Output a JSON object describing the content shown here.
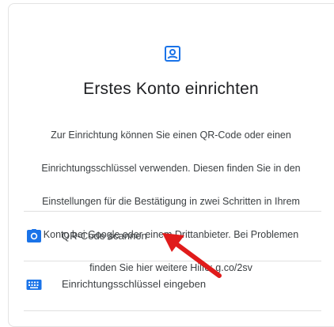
{
  "colors": {
    "accent": "#1a73e8",
    "annotation_arrow": "#e01b1b",
    "title": "#202124",
    "body_text": "#3c4043",
    "divider": "#e0e0e0"
  },
  "header": {
    "icon": "account-box-icon",
    "title": "Erstes Konto einrichten"
  },
  "description": {
    "line1": "Zur Einrichtung können Sie einen QR-Code oder einen",
    "line2": "Einrichtungsschlüssel verwenden. Diesen finden Sie in den",
    "line3": "Einstellungen für die Bestätigung in zwei Schritten in Ihrem",
    "line4": "Konto bei Google oder einem Drittanbieter. Bei Problemen",
    "line5": "finden Sie hier weitere Hilfe: g.co/2sv"
  },
  "options": [
    {
      "icon": "camera-icon",
      "label": "QR-Code scannen"
    },
    {
      "icon": "keyboard-icon",
      "label": "Einrichtungsschlüssel eingeben"
    }
  ],
  "annotation": {
    "icon": "red-arrow-icon"
  }
}
